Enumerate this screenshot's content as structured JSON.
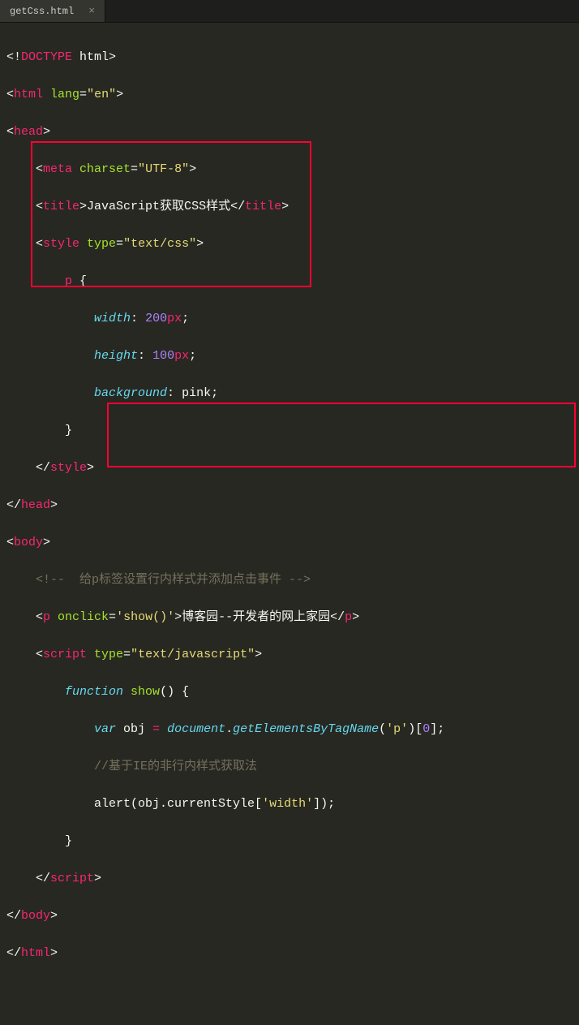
{
  "tab": {
    "filename": "getCss.html",
    "close": "×"
  },
  "code": {
    "l1": {
      "a": "<!",
      "b": "DOCTYPE",
      "c": " html",
      "d": ">"
    },
    "l2": {
      "a": "<",
      "b": "html",
      "c": " lang",
      "d": "=",
      "e": "\"en\"",
      "f": ">"
    },
    "l3": {
      "a": "<",
      "b": "head",
      "c": ">"
    },
    "l4": {
      "a": "    <",
      "b": "meta",
      "c": " charset",
      "d": "=",
      "e": "\"UTF-8\"",
      "f": ">"
    },
    "l5": {
      "a": "    <",
      "b": "title",
      "c": ">",
      "d": "JavaScript获取CSS样式",
      "e": "</",
      "f": "title",
      "g": ">"
    },
    "l6": {
      "a": "    <",
      "b": "style",
      "c": " type",
      "d": "=",
      "e": "\"text/css\"",
      "f": ">"
    },
    "l7": {
      "a": "        ",
      "b": "p",
      "c": " {"
    },
    "l8": {
      "a": "            ",
      "b": "width",
      "c": ": ",
      "d": "200",
      "e": "px",
      "f": ";"
    },
    "l9": {
      "a": "            ",
      "b": "height",
      "c": ": ",
      "d": "100",
      "e": "px",
      "f": ";"
    },
    "l10": {
      "a": "            ",
      "b": "background",
      "c": ": ",
      "d": "pink",
      "e": ";"
    },
    "l11": {
      "a": "        }"
    },
    "l12": {
      "a": "    </",
      "b": "style",
      "c": ">"
    },
    "l13": {
      "a": "</",
      "b": "head",
      "c": ">"
    },
    "l14": {
      "a": "<",
      "b": "body",
      "c": ">"
    },
    "l15": {
      "a": "    ",
      "b": "<!--  给p标签设置行内样式并添加点击事件 -->"
    },
    "l16": {
      "a": "    <",
      "b": "p",
      "c": " onclick",
      "d": "=",
      "e": "'show()'",
      "f": ">",
      "g": "博客园--开发者的网上家园",
      "h": "</",
      "i": "p",
      "j": ">"
    },
    "l17": {
      "a": "    <",
      "b": "script",
      "c": " type",
      "d": "=",
      "e": "\"text/javascript\"",
      "f": ">"
    },
    "l18": {
      "a": "        ",
      "b": "function",
      "c": " ",
      "d": "show",
      "e": "() {"
    },
    "l19": {
      "a": "            ",
      "b": "var",
      "c": " obj ",
      "d": "=",
      "e": " ",
      "f": "document",
      "g": ".",
      "h": "getElementsByTagName",
      "i": "(",
      "j": "'p'",
      "k": ")[",
      "l": "0",
      "m": "];"
    },
    "l20": {
      "a": "            ",
      "b": "//基于IE的非行内样式获取法"
    },
    "l21": {
      "a": "            alert(obj.currentStyle[",
      "b": "'width'",
      "c": "]);"
    },
    "l22": {
      "a": "        }"
    },
    "l23": {
      "a": "    </",
      "b": "script",
      "c": ">"
    },
    "l24": {
      "a": "</",
      "b": "body",
      "c": ">"
    },
    "l25": {
      "a": "</",
      "b": "html",
      "c": ">"
    }
  }
}
